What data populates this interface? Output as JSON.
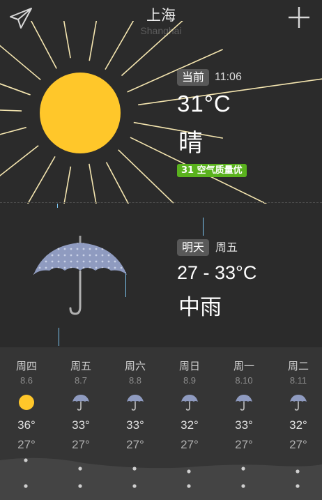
{
  "header": {
    "city": "上海",
    "city_en": "Shanghai",
    "left_icon": "paper-plane-icon",
    "right_icon": "plus-icon"
  },
  "current": {
    "badge": "当前",
    "time": "11:06",
    "temperature": "31°C",
    "condition": "晴",
    "aqi_text": "31 空气质量优",
    "aqi_color": "#5ab21e",
    "icon": "sun-icon"
  },
  "tomorrow": {
    "badge": "明天",
    "weekday": "周五",
    "temperature": "27 - 33°C",
    "condition": "中雨",
    "icon": "umbrella-icon"
  },
  "forecast": [
    {
      "weekday": "周四",
      "date": "8.6",
      "icon": "sun-icon",
      "high": "36°",
      "low": "27°"
    },
    {
      "weekday": "周五",
      "date": "8.7",
      "icon": "umbrella-icon",
      "high": "33°",
      "low": "27°"
    },
    {
      "weekday": "周六",
      "date": "8.8",
      "icon": "umbrella-icon",
      "high": "33°",
      "low": "27°"
    },
    {
      "weekday": "周日",
      "date": "8.9",
      "icon": "umbrella-icon",
      "high": "32°",
      "low": "27°"
    },
    {
      "weekday": "周一",
      "date": "8.10",
      "icon": "umbrella-icon",
      "high": "33°",
      "low": "27°"
    },
    {
      "weekday": "周二",
      "date": "8.11",
      "icon": "umbrella-icon",
      "high": "32°",
      "low": "27°"
    }
  ],
  "colors": {
    "background": "#2b2b2b",
    "sun": "#ffc72a",
    "rays": "#f5e6b0",
    "rain": "#7cc5f0",
    "badge": "#585858"
  }
}
